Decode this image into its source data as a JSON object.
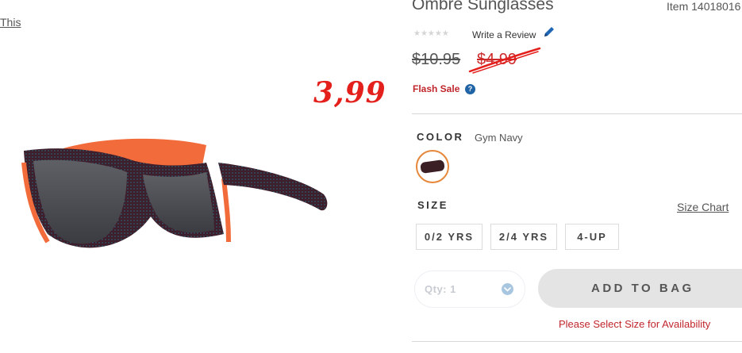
{
  "breadcrumb_fragment": "This",
  "annotation_price": "3,99",
  "product": {
    "title": "Ombre Sunglasses",
    "item_number": "Item 14018016"
  },
  "reviews": {
    "stars": "★★★★★",
    "write_review_label": "Write a Review",
    "icon": "pencil-icon"
  },
  "pricing": {
    "original": "$10.95",
    "sale": "$4.99",
    "flash_sale_label": "Flash Sale",
    "help_glyph": "?",
    "sale_color": "#cc2a2a"
  },
  "color": {
    "label": "COLOR",
    "selected": "Gym Navy",
    "swatch_color": "#3a1f24",
    "swatch_border": "#e6873a"
  },
  "size": {
    "label": "SIZE",
    "chart_link": "Size Chart",
    "options": [
      "0/2 YRS",
      "2/4 YRS",
      "4-UP"
    ]
  },
  "purchase": {
    "qty_label": "Qty: 1",
    "add_to_bag_label": "ADD TO BAG",
    "availability_message": "Please Select Size for Availability"
  }
}
